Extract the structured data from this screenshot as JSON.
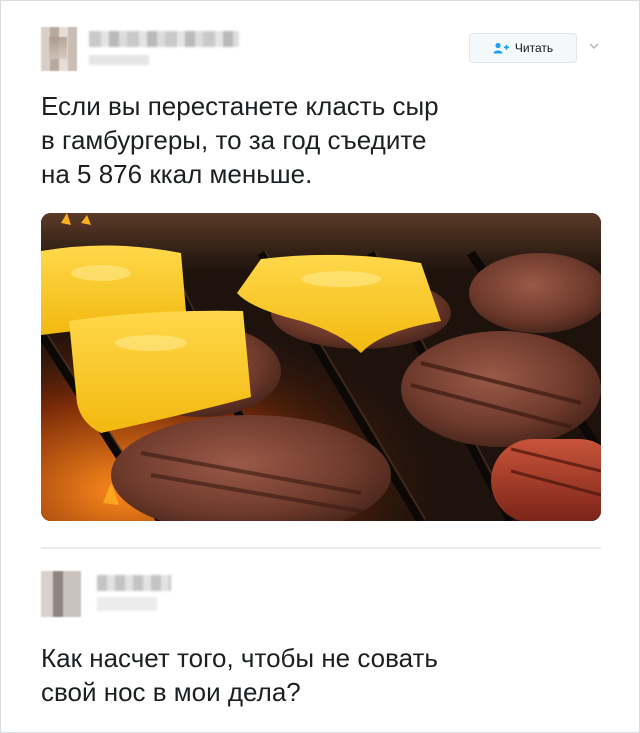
{
  "tweet1": {
    "follow_label": "Читать",
    "text_lines": [
      "Если вы перестанете класть сыр",
      "в гамбургеры, то за год съедите",
      "на 5 876 ккал меньше."
    ],
    "photo_icon": "cheeseburgers-on-grill-photo"
  },
  "tweet2": {
    "text_lines": [
      "Как насчет того, чтобы не совать",
      "свой нос в мои дела?"
    ]
  },
  "colors": {
    "text": "#1c2022",
    "follow_button_bg": "#f5f8fa",
    "follow_icon": "#1da1f2",
    "divider": "#e6ecf0"
  }
}
